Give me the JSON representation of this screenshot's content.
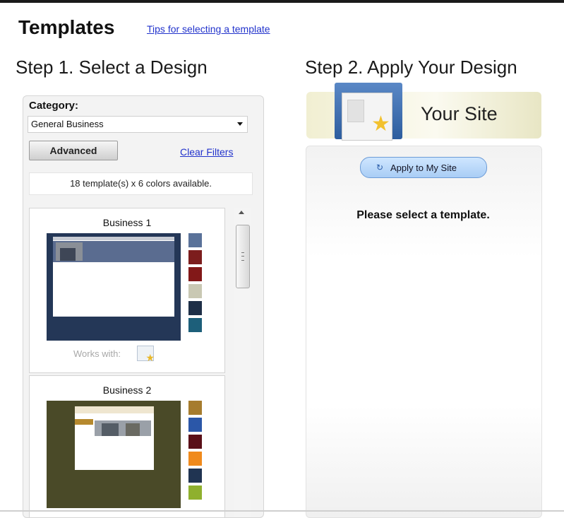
{
  "header": {
    "title": "Templates",
    "tips_link": "Tips for selecting a template"
  },
  "step1": {
    "heading": "Step 1. Select a Design"
  },
  "step2": {
    "heading": "Step 2. Apply Your Design"
  },
  "filters": {
    "category_label": "Category:",
    "category_value": "General Business",
    "advanced_label": "Advanced",
    "clear_filters_label": "Clear Filters",
    "count_text": "18 template(s) x 6 colors available."
  },
  "templates": [
    {
      "name": "Business 1",
      "works_with": "Works with:",
      "swatches": [
        "#5a7299",
        "#7c1d1d",
        "#821818",
        "#c9c8b3",
        "#1e2f47",
        "#1d5f7a"
      ]
    },
    {
      "name": "Business 2",
      "swatches": [
        "#a67c2e",
        "#2b57a8",
        "#5a0f18",
        "#f08a1c",
        "#203452",
        "#8fb02e"
      ]
    }
  ],
  "banner": {
    "label": "Your Site"
  },
  "apply": {
    "button_label": "Apply to My Site",
    "message": "Please select a template."
  },
  "colors": {
    "link": "#2233cc",
    "apply_button": "#a9cdf5"
  }
}
